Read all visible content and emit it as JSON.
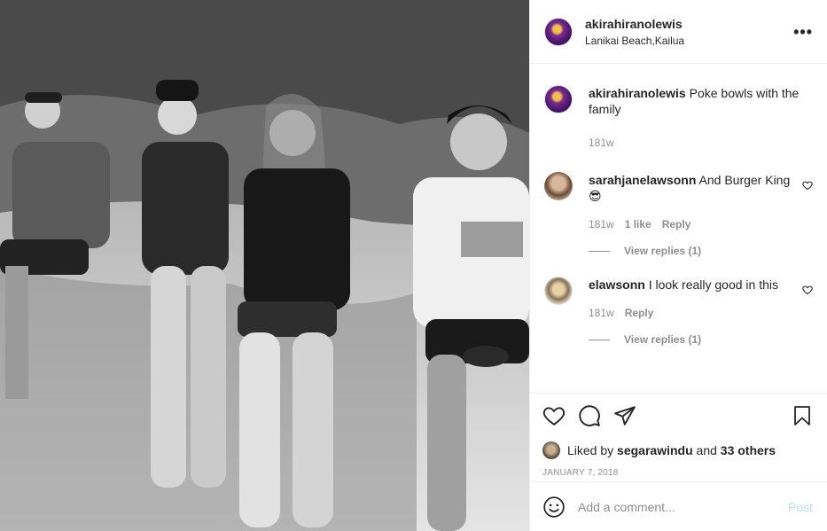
{
  "header": {
    "username": "akirahiranolewis",
    "location": "Lanikai Beach,Kailua",
    "more_label": "•••"
  },
  "caption": {
    "username": "akirahiranolewis",
    "text": "Poke bowls with the family",
    "age": "181w"
  },
  "comments": [
    {
      "username": "sarahjanelawsonn",
      "text": "And Burger King 😎",
      "age": "181w",
      "likes": "1 like",
      "reply_label": "Reply",
      "view_replies": "View replies (1)"
    },
    {
      "username": "elawsonn",
      "text": "I look really good in this",
      "age": "181w",
      "reply_label": "Reply",
      "view_replies": "View replies (1)"
    }
  ],
  "likes": {
    "prefix": "Liked by",
    "user": "segarawindu",
    "and": "and",
    "others": "33 others"
  },
  "date": "JANUARY 7, 2018",
  "add_comment": {
    "placeholder": "Add a comment...",
    "post_label": "Post"
  },
  "icons": {
    "like": "heart-icon",
    "comment": "comment-icon",
    "share": "paper-plane-icon",
    "save": "bookmark-icon",
    "emoji": "smiley-icon",
    "comment_like": "heart-icon"
  },
  "colors": {
    "text": "#262626",
    "muted": "#8e8e8e",
    "border": "#efefef",
    "post_disabled": "#b2dffc"
  }
}
